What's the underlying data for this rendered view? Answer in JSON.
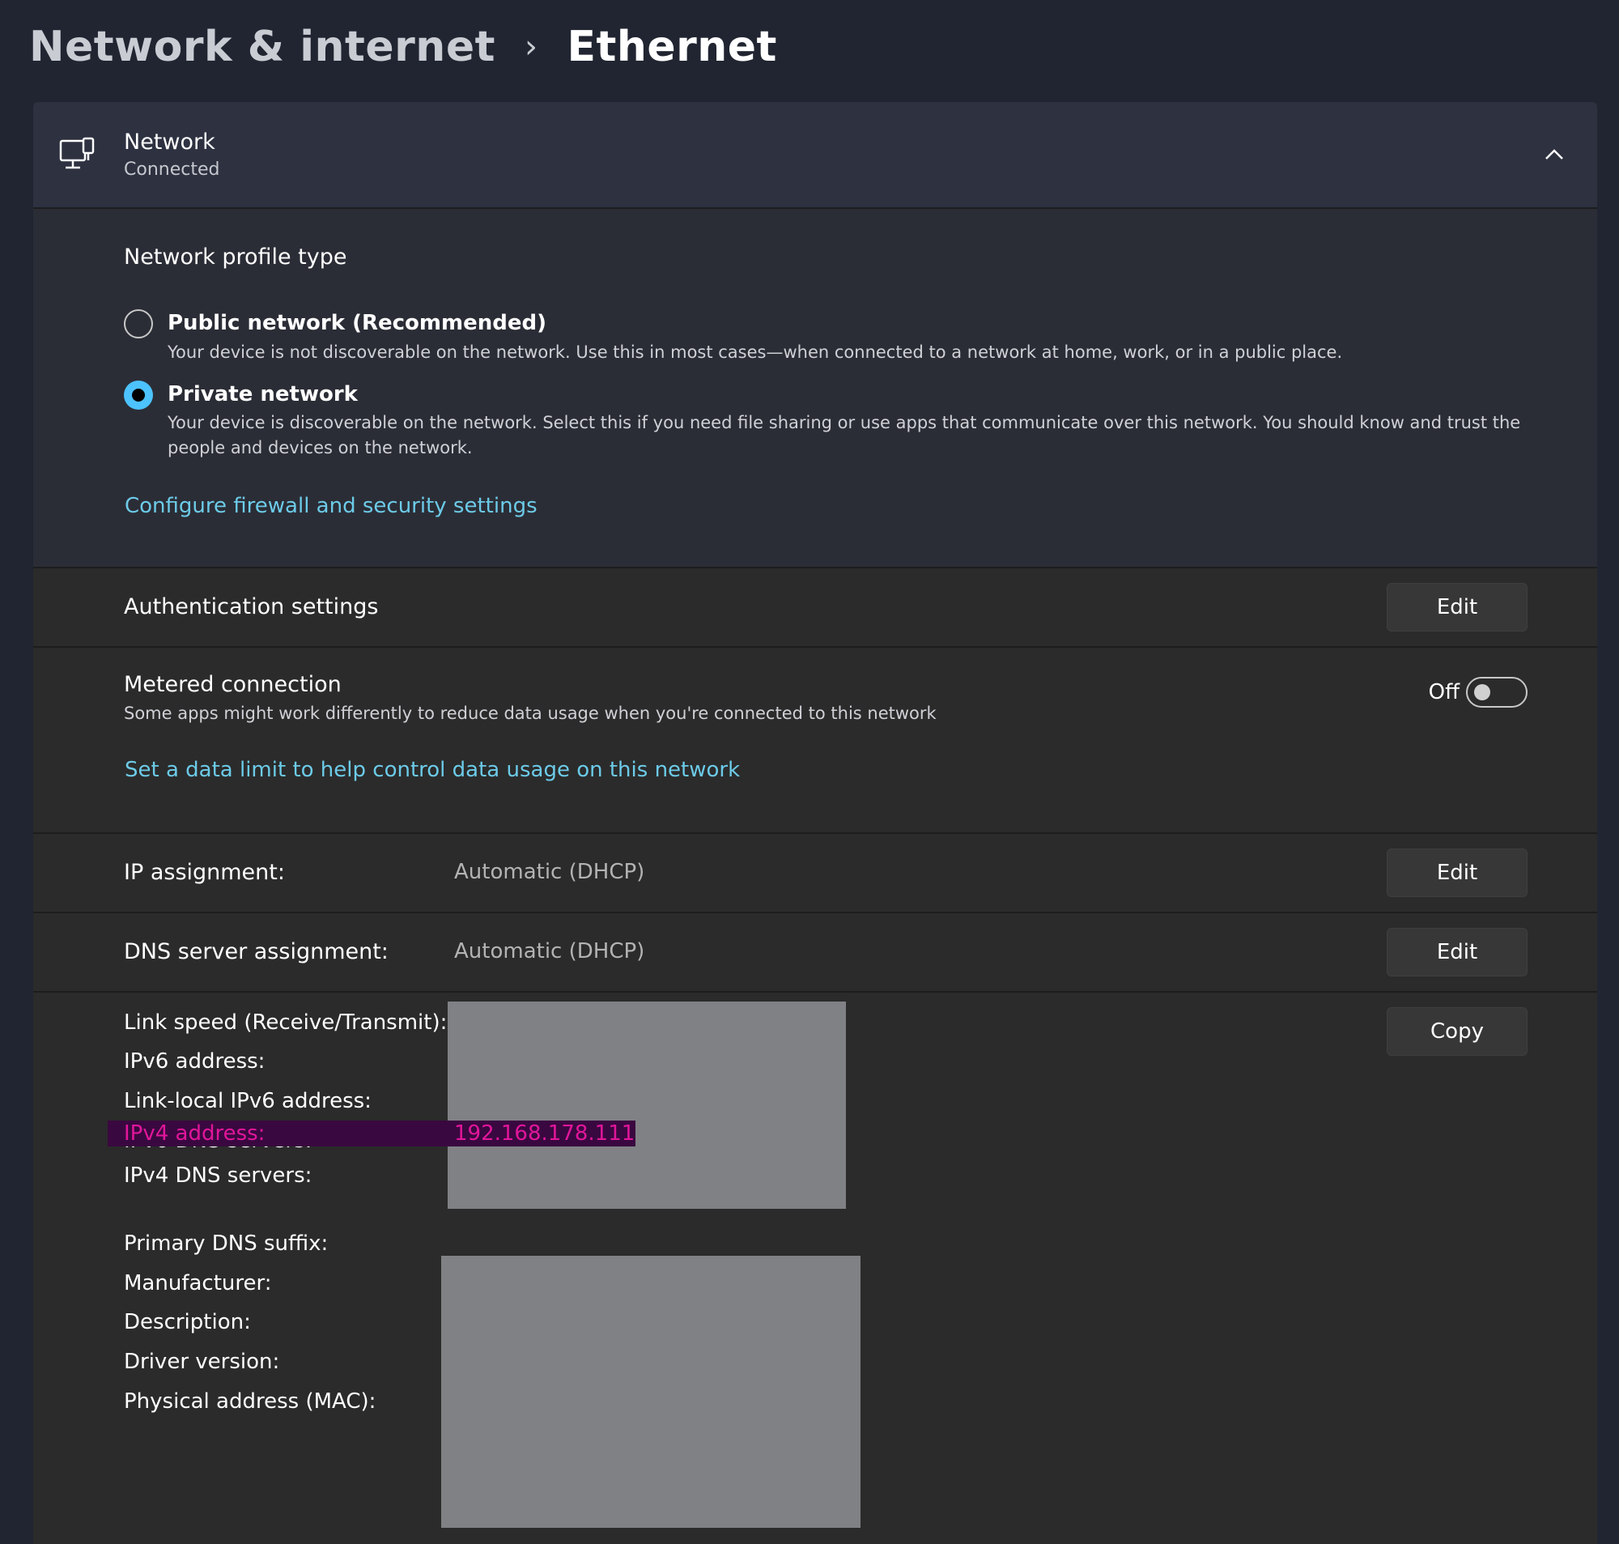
{
  "breadcrumb": {
    "parent": "Network & internet",
    "separator": "›",
    "current": "Ethernet"
  },
  "network_header": {
    "icon": "network-monitor-icon",
    "title": "Network",
    "status": "Connected",
    "expand_icon": "chevron-up-icon"
  },
  "profile": {
    "heading": "Network profile type",
    "options": [
      {
        "title": "Public network (Recommended)",
        "description": "Your device is not discoverable on the network. Use this in most cases—when connected to a network at home, work, or in a public place.",
        "selected": false
      },
      {
        "title": "Private network",
        "description_line1": "Your device is discoverable on the network. Select this if you need file sharing or use apps that communicate over this network. You should know and trust the",
        "description_line2": "people and devices on the network.",
        "selected": true
      }
    ],
    "firewall_link": "Configure firewall and security settings"
  },
  "authentication": {
    "label": "Authentication settings",
    "button": "Edit"
  },
  "metered": {
    "title": "Metered connection",
    "description": "Some apps might work differently to reduce data usage when you're connected to this network",
    "toggle_state": "Off",
    "data_limit_link": "Set a data limit to help control data usage on this network"
  },
  "ip_assignment": {
    "label": "IP assignment:",
    "value": "Automatic (DHCP)",
    "button": "Edit"
  },
  "dns_assignment": {
    "label": "DNS server assignment:",
    "value": "Automatic (DHCP)",
    "button": "Edit"
  },
  "details": {
    "copy_button": "Copy",
    "labels": {
      "link_speed": "Link speed (Receive/Transmit):",
      "ipv6_address": "IPv6 address:",
      "link_local_ipv6": "Link-local IPv6 address:",
      "ipv6_dns": "IPv6 DNS servers:",
      "ipv4_address": "IPv4 address:",
      "ipv4_dns": "IPv4 DNS servers:",
      "primary_dns_suffix": "Primary DNS suffix:",
      "manufacturer": "Manufacturer:",
      "description": "Description:",
      "driver_version": "Driver version:",
      "mac": "Physical address (MAC):"
    },
    "ipv4_value": "192.168.178.111"
  },
  "colors": {
    "accent": "#4cc2ff",
    "link": "#6ccbe8",
    "highlight_text": "#e0169a",
    "highlight_bg": "#3a0840",
    "redaction": "#808185"
  }
}
